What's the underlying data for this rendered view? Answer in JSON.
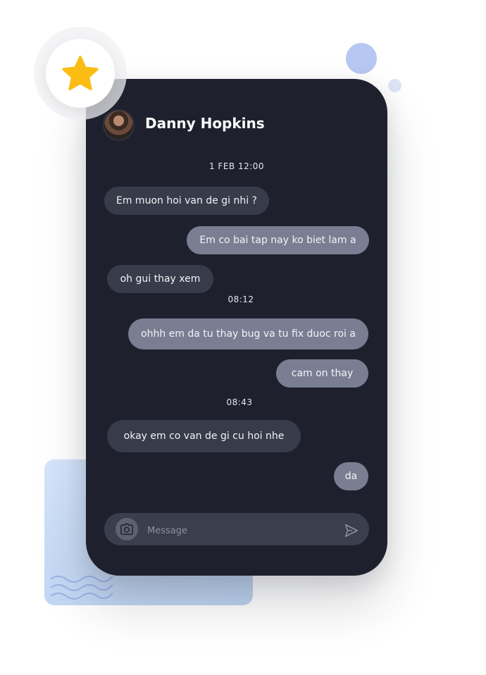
{
  "chat": {
    "contact_name": "Danny Hopkins",
    "timestamps": [
      "1 FEB 12:00",
      "08:12",
      "08:43"
    ],
    "messages": [
      {
        "direction": "incoming",
        "text": "Em muon hoi van de gi nhi ?"
      },
      {
        "direction": "outgoing",
        "text": "Em co bai tap nay ko biet lam a"
      },
      {
        "direction": "incoming",
        "text": "oh gui thay xem"
      },
      {
        "direction": "outgoing",
        "text": "ohhh em da tu thay bug va tu fix duoc roi a"
      },
      {
        "direction": "outgoing",
        "text": "cam on thay"
      },
      {
        "direction": "incoming",
        "text": "okay em co van de gi cu hoi nhe"
      },
      {
        "direction": "outgoing",
        "text": "da"
      }
    ]
  },
  "composer": {
    "placeholder": "Message",
    "camera_icon": "camera-icon",
    "send_icon": "send-icon"
  },
  "colors": {
    "phone_bg": "#1e212d",
    "incoming_bubble": "#383b4a",
    "outgoing_bubble": "#7a7e93",
    "star": "#fbbd14",
    "accent_dot": "#b6c8f1"
  }
}
